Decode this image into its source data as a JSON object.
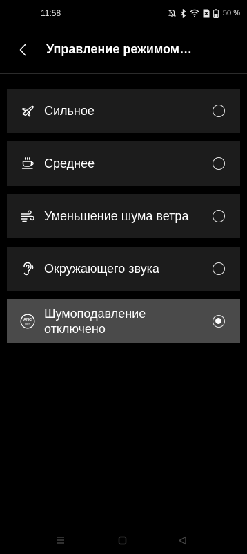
{
  "status_bar": {
    "time": "11:58",
    "battery_percent": "50 %",
    "icons": [
      "mute-icon",
      "bluetooth-icon",
      "wifi-icon",
      "sim-x-icon",
      "battery-icon"
    ]
  },
  "header": {
    "title": "Управление режимом…",
    "back_icon": "back-arrow-icon"
  },
  "options": [
    {
      "label": "Сильное",
      "icon": "airplane-icon",
      "selected": false
    },
    {
      "label": "Среднее",
      "icon": "coffee-cup-icon",
      "selected": false
    },
    {
      "label": "Уменьшение шума ветра",
      "icon": "wind-icon",
      "selected": false
    },
    {
      "label": "Окружающего звука",
      "icon": "ear-icon",
      "selected": false
    },
    {
      "label": "Шумоподавление\nотключено",
      "icon": "anc-off-icon",
      "selected": true
    }
  ],
  "anc_icon_text": {
    "top": "ANC",
    "bottom": "OFF"
  },
  "nav_bar": {
    "buttons": [
      "recents-icon",
      "home-icon",
      "back-icon"
    ]
  },
  "colors": {
    "background": "#000000",
    "row": "#1c1c1c",
    "row_selected": "#4a4a4a",
    "text": "#ffffff"
  }
}
